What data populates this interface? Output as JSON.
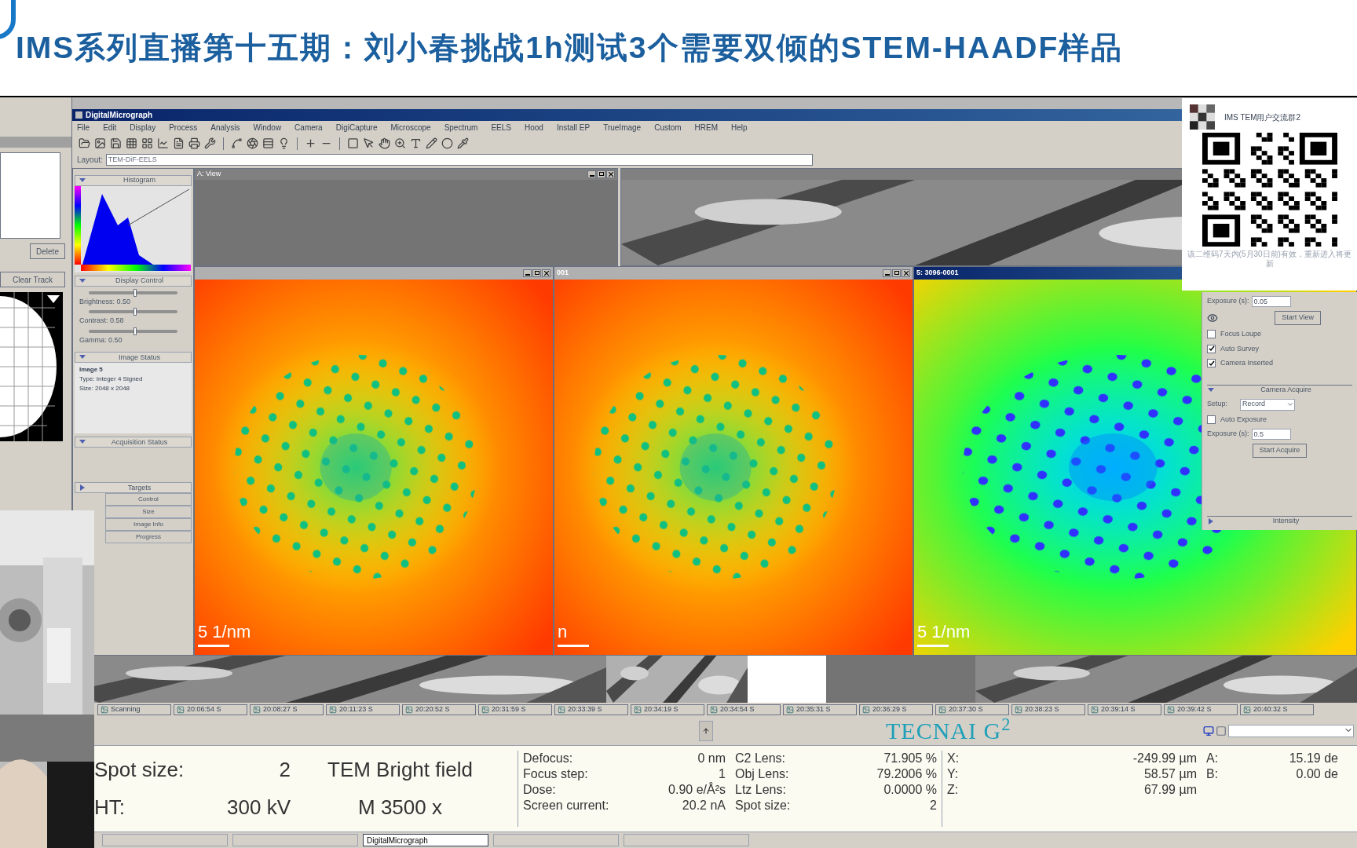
{
  "banner": {
    "title": "IMS系列直播第十五期：刘小春挑战1h测试3个需要双倾的STEM-HAADF样品"
  },
  "side_panel": {
    "buttons": [
      "Delete",
      "Clear Track"
    ]
  },
  "app": {
    "title": "DigitalMicrograph",
    "menu": [
      "File",
      "Edit",
      "Display",
      "Process",
      "Analysis",
      "Window",
      "Camera",
      "DigiCapture",
      "Microscope",
      "Spectrum",
      "EELS",
      "Hood",
      "Install EP",
      "TrueImage",
      "Custom",
      "HREM",
      "Help"
    ],
    "layout_label": "Layout:",
    "layout_value": "TEM-DiF-EELS"
  },
  "palette": {
    "sections": [
      {
        "kind": "histogram",
        "title": "Histogram",
        "expanded": true
      },
      {
        "kind": "display",
        "title": "Display Control",
        "expanded": true,
        "sliders": [
          {
            "label": "Brightness: 0.50",
            "level": 0.5
          },
          {
            "label": "Contrast: 0.58",
            "level": 0.5
          },
          {
            "label": "Gamma: 0.50",
            "level": 0.5
          }
        ]
      },
      {
        "kind": "status",
        "title": "Image Status",
        "expanded": true,
        "lines": [
          {
            "text": "Image 5",
            "bold": true
          },
          {
            "text": "Type: Integer 4 Signed",
            "bold": false
          },
          {
            "text": "Size: 2048 x 2048",
            "bold": false
          }
        ]
      },
      {
        "kind": "empty",
        "title": "Acquisition Status",
        "expanded": true
      },
      {
        "kind": "group",
        "title": "Targets",
        "expanded": false,
        "buttons": [
          "Control",
          "Size",
          "Image Info",
          "Progress"
        ]
      }
    ]
  },
  "image_windows_top": [
    {
      "title": "A: View",
      "active": false,
      "kind": "noise"
    },
    {
      "active": false,
      "kind": "texture"
    }
  ],
  "diffraction_windows": [
    {
      "active": false,
      "kind": "warm",
      "scale_label": "5 1/nm"
    },
    {
      "title": "001",
      "active": false,
      "kind": "warm",
      "scale_label": "n"
    },
    {
      "title": "5: 3096-0001",
      "active": true,
      "kind": "cool",
      "scale_label": "5 1/nm"
    }
  ],
  "camera_panel": {
    "view_exposure_label": "Exposure (s):",
    "view_exposure": "0.05",
    "start_view": "Start View",
    "options": [
      {
        "label": "Focus Loupe",
        "checked": false
      },
      {
        "label": "Auto Survey",
        "checked": true
      },
      {
        "label": "Camera Inserted",
        "checked": true
      }
    ],
    "acquire_title": "Camera Acquire",
    "setup_label": "Setup:",
    "setup_value": "Record",
    "auto_exposure": {
      "label": "Auto Exposure",
      "checked": false
    },
    "acquire_exposure_label": "Exposure (s):",
    "acquire_exposure": "0.5",
    "start_acquire": "Start Acquire",
    "intensity_title": "Intensity",
    "intensity_expanded": false
  },
  "qr_card": {
    "group_name": "IMS TEM用户交流群2",
    "caption": "该二维码7天内(5月30日前)有效，重新进入将更新"
  },
  "image_tabs": [
    "Scanning",
    "20:06:54 S",
    "20:08:27 S",
    "20:11:23 S",
    "20:20:52 S",
    "20:31:59 S",
    "20:33:39 S",
    "20:34:19 S",
    "20:34:54 S",
    "20:35:31 S",
    "20:36:29 S",
    "20:37:30 S",
    "20:38:23 S",
    "20:39:14 S",
    "20:39:42 S",
    "20:40:32 S"
  ],
  "tecnai": {
    "logo": "TECNAI G$^{2}$",
    "mode_rows": [
      {
        "label": "Spot size:",
        "value": "2",
        "mode": "TEM Bright field"
      },
      {
        "label": "HT:",
        "value": "300 kV",
        "mode": "M 3500 x"
      }
    ],
    "optics": [
      [
        "Defocus:",
        "0 nm"
      ],
      [
        "Focus step:",
        "1"
      ],
      [
        "Dose:",
        "0.90 e/Å²s"
      ],
      [
        "Screen current:",
        "20.2 nA"
      ]
    ],
    "lenses": [
      [
        "C2 Lens:",
        "71.905 %"
      ],
      [
        "Obj Lens:",
        "79.2006 %"
      ],
      [
        "Ltz Lens:",
        "0.0000 %"
      ],
      [
        "Spot size:",
        "2"
      ]
    ],
    "stage": [
      [
        "X:",
        "-249.99 µm"
      ],
      [
        "Y:",
        "58.57 µm"
      ],
      [
        "Z:",
        "67.99 µm"
      ]
    ],
    "tilt": [
      [
        "A:",
        "15.19 de"
      ],
      [
        "B:",
        "0.00 de"
      ]
    ]
  },
  "taskbar": [
    {
      "selected": false
    },
    {
      "selected": false
    },
    {
      "label": "DigitalMicrograph",
      "selected": true
    },
    {
      "selected": false
    },
    {
      "selected": false
    }
  ]
}
